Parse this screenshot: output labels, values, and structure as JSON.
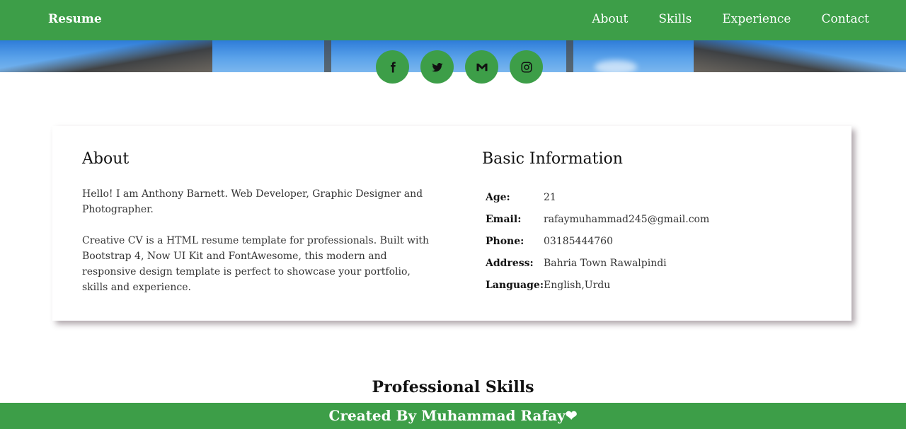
{
  "nav": {
    "brand": "Resume",
    "links": [
      "About",
      "Skills",
      "Experience",
      "Contact"
    ]
  },
  "social": {
    "icons": [
      "facebook-icon",
      "twitter-icon",
      "gmail-icon",
      "instagram-icon"
    ]
  },
  "about": {
    "title": "About",
    "paragraphs": [
      "Hello! I am Anthony Barnett. Web Developer, Graphic Designer and Photographer.",
      "Creative CV is a HTML resume template for professionals. Built with Bootstrap 4, Now UI Kit and FontAwesome, this modern and responsive design template is perfect to showcase your portfolio, skills and experience."
    ]
  },
  "basic_info": {
    "title": "Basic Information",
    "rows": [
      {
        "label": "Age:",
        "value": "21"
      },
      {
        "label": "Email:",
        "value": "rafaymuhammad245@gmail.com"
      },
      {
        "label": "Phone:",
        "value": "03185444760"
      },
      {
        "label": "Address:",
        "value": "Bahria Town Rawalpindi"
      },
      {
        "label": "Language:",
        "value": "English,Urdu"
      }
    ]
  },
  "skills": {
    "title": "Professional Skills"
  },
  "footer": {
    "text": "Created By Muhammad Rafay",
    "heart": "❤"
  },
  "colors": {
    "primary": "#3d9e48",
    "text": "#222222",
    "sky": "#5aa2ea"
  }
}
